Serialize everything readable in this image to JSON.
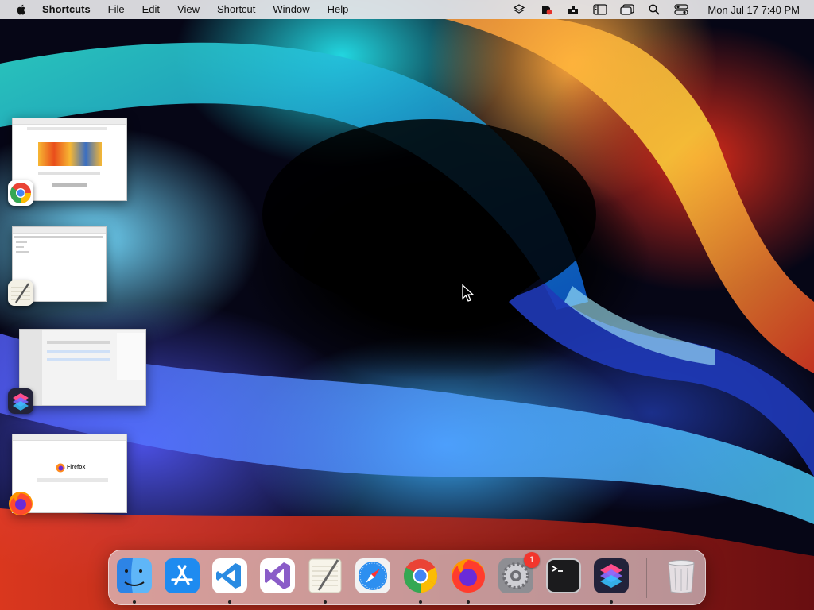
{
  "menubar": {
    "app_name": "Shortcuts",
    "menus": [
      "File",
      "Edit",
      "View",
      "Shortcut",
      "Window",
      "Help"
    ],
    "status_icons": [
      "layers-icon",
      "app-badge-icon",
      "inbox-tray-icon",
      "sidebar-icon",
      "windows-icon",
      "search-icon",
      "control-center-icon"
    ],
    "clock": "Mon Jul 17  7:40 PM"
  },
  "windows": [
    {
      "app": "Google Chrome",
      "icon": "chrome-icon"
    },
    {
      "app": "TextEdit",
      "icon": "textedit-icon"
    },
    {
      "app": "Shortcuts",
      "icon": "shortcuts-icon"
    },
    {
      "app": "Firefox",
      "icon": "firefox-icon",
      "page_title": "Firefox"
    }
  ],
  "dock": {
    "apps": [
      {
        "name": "Finder",
        "icon": "finder-icon",
        "running": true
      },
      {
        "name": "App Store",
        "icon": "app-store-icon",
        "running": false
      },
      {
        "name": "Visual Studio Code",
        "icon": "vscode-icon",
        "running": true
      },
      {
        "name": "Visual Studio",
        "icon": "visual-studio-icon",
        "running": false
      },
      {
        "name": "TextEdit",
        "icon": "textedit-icon",
        "running": true
      },
      {
        "name": "Safari",
        "icon": "safari-icon",
        "running": false
      },
      {
        "name": "Google Chrome",
        "icon": "chrome-icon",
        "running": true
      },
      {
        "name": "Firefox",
        "icon": "firefox-icon",
        "running": true
      },
      {
        "name": "System Settings",
        "icon": "settings-gear-icon",
        "running": false,
        "badge": "1"
      },
      {
        "name": "Terminal",
        "icon": "terminal-icon",
        "running": false
      },
      {
        "name": "Shortcuts",
        "icon": "shortcuts-icon",
        "running": true
      },
      {
        "name": "Trash",
        "icon": "trash-icon",
        "running": false
      }
    ]
  },
  "colors": {
    "menubar_bg": "#e8e8ec",
    "badge_red": "#f2352d",
    "chrome_red": "#ea4335",
    "chrome_yellow": "#fbbc04",
    "chrome_green": "#34a853",
    "chrome_blue": "#4285f4",
    "vscode_blue": "#2a8be2",
    "vs_purple": "#8a5cc8"
  }
}
